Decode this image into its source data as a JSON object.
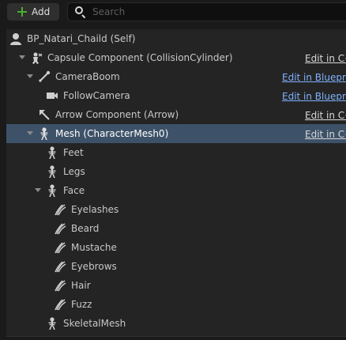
{
  "toolbar": {
    "add_label": "Add",
    "search_placeholder": "Search"
  },
  "tree": {
    "rows": [
      {
        "label": "BP_Natari_Chaild (Self)",
        "icon": "actor-icon",
        "edit": ""
      },
      {
        "label": "Capsule Component (CollisionCylinder)",
        "icon": "capsule-icon",
        "edit": "Edit in C++"
      },
      {
        "label": "CameraBoom",
        "icon": "spring-arm-icon",
        "edit": "Edit in Blueprint"
      },
      {
        "label": "FollowCamera",
        "icon": "camera-icon",
        "edit": "Edit in Blueprint"
      },
      {
        "label": "Arrow Component (Arrow)",
        "icon": "arrow-icon",
        "edit": "Edit in C++"
      },
      {
        "label": "Mesh (CharacterMesh0)",
        "icon": "skeletal-mesh-icon",
        "edit": "Edit in C++"
      },
      {
        "label": "Feet",
        "icon": "skeletal-mesh-icon",
        "edit": ""
      },
      {
        "label": "Legs",
        "icon": "skeletal-mesh-icon",
        "edit": ""
      },
      {
        "label": "Face",
        "icon": "skeletal-mesh-icon",
        "edit": ""
      },
      {
        "label": "Eyelashes",
        "icon": "groom-icon",
        "edit": ""
      },
      {
        "label": "Beard",
        "icon": "groom-icon",
        "edit": ""
      },
      {
        "label": "Mustache",
        "icon": "groom-icon",
        "edit": ""
      },
      {
        "label": "Eyebrows",
        "icon": "groom-icon",
        "edit": ""
      },
      {
        "label": "Hair",
        "icon": "groom-icon",
        "edit": ""
      },
      {
        "label": "Fuzz",
        "icon": "groom-icon",
        "edit": ""
      },
      {
        "label": "SkeletalMesh",
        "icon": "skeletal-mesh-icon",
        "edit": ""
      }
    ],
    "selected_row": "Mesh (CharacterMesh0)"
  },
  "colors": {
    "accent_add": "#4caf30",
    "selection": "#3d5268",
    "link_blue": "#7fb2ff"
  }
}
